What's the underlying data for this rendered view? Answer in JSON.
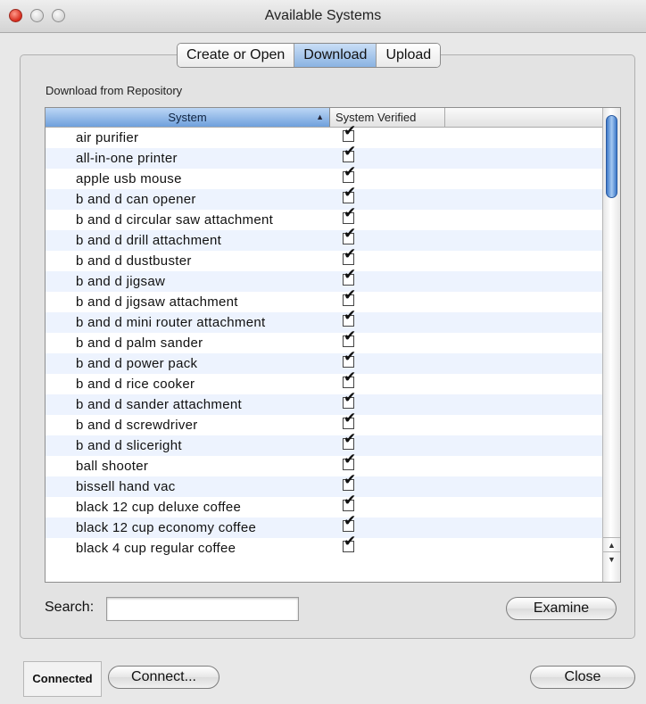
{
  "window": {
    "title": "Available Systems"
  },
  "tabs": [
    {
      "label": "Create or Open"
    },
    {
      "label": "Download"
    },
    {
      "label": "Upload"
    }
  ],
  "active_tab": "Download",
  "section_label": "Download from Repository",
  "table": {
    "columns": [
      {
        "label": "System",
        "sorted": "ascending"
      },
      {
        "label": "System Verified"
      }
    ],
    "rows": [
      {
        "system": "air purifier",
        "verified": true
      },
      {
        "system": "all-in-one printer",
        "verified": true
      },
      {
        "system": "apple usb mouse",
        "verified": true
      },
      {
        "system": "b and d can opener",
        "verified": true
      },
      {
        "system": "b and d circular saw attachment",
        "verified": true
      },
      {
        "system": "b and d drill attachment",
        "verified": true
      },
      {
        "system": "b and d dustbuster",
        "verified": true
      },
      {
        "system": "b and d jigsaw",
        "verified": true
      },
      {
        "system": "b and d jigsaw attachment",
        "verified": true
      },
      {
        "system": "b and d mini router attachment",
        "verified": true
      },
      {
        "system": "b and d palm sander",
        "verified": true
      },
      {
        "system": "b and d power pack",
        "verified": true
      },
      {
        "system": "b and d rice cooker",
        "verified": true
      },
      {
        "system": "b and d sander attachment",
        "verified": true
      },
      {
        "system": "b and d screwdriver",
        "verified": true
      },
      {
        "system": "b and d sliceright",
        "verified": true
      },
      {
        "system": "ball shooter",
        "verified": true
      },
      {
        "system": "bissell hand vac",
        "verified": true
      },
      {
        "system": "black 12 cup deluxe coffee",
        "verified": true
      },
      {
        "system": "black 12 cup economy coffee",
        "verified": true
      },
      {
        "system": "black 4 cup regular coffee",
        "verified": true
      }
    ]
  },
  "search": {
    "label": "Search:",
    "value": "",
    "placeholder": ""
  },
  "buttons": {
    "examine": "Examine",
    "connect": "Connect...",
    "close": "Close"
  },
  "status": "Connected",
  "colors": {
    "selected_tab": "#8ab3e2",
    "sorted_header": "#6fa0dc",
    "alt_row": "#edf3fe",
    "scroll_thumb": "#3c78c8"
  },
  "icons": {
    "sort": "sort-ascending-icon",
    "scroll_up": "scroll-up-arrow-icon",
    "scroll_down": "scroll-down-arrow-icon"
  }
}
